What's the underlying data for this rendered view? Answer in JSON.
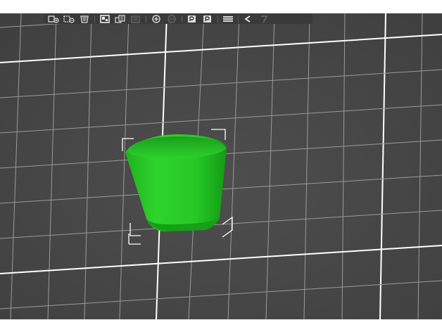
{
  "app": {
    "canvas_background": "#4a4a4a",
    "grid_color": "#9a9a9a",
    "grid_major_color": "#ffffff",
    "model_color": "#2fd12f",
    "selection_color": "#ffffff"
  },
  "toolbar": {
    "buttons": [
      {
        "icon": "add-object-icon"
      },
      {
        "icon": "remove-object-icon"
      },
      {
        "icon": "delete-all-icon"
      },
      {
        "icon": "arrange-icon"
      },
      {
        "icon": "copy-icon"
      },
      {
        "icon": "paste-icon"
      },
      {
        "icon": "add-instance-icon"
      },
      {
        "icon": "remove-instance-icon"
      },
      {
        "icon": "split-to-objects-icon"
      },
      {
        "icon": "split-to-parts-icon"
      },
      {
        "icon": "layers-editing-icon"
      },
      {
        "icon": "undo-icon"
      },
      {
        "icon": "redo-icon"
      }
    ]
  }
}
